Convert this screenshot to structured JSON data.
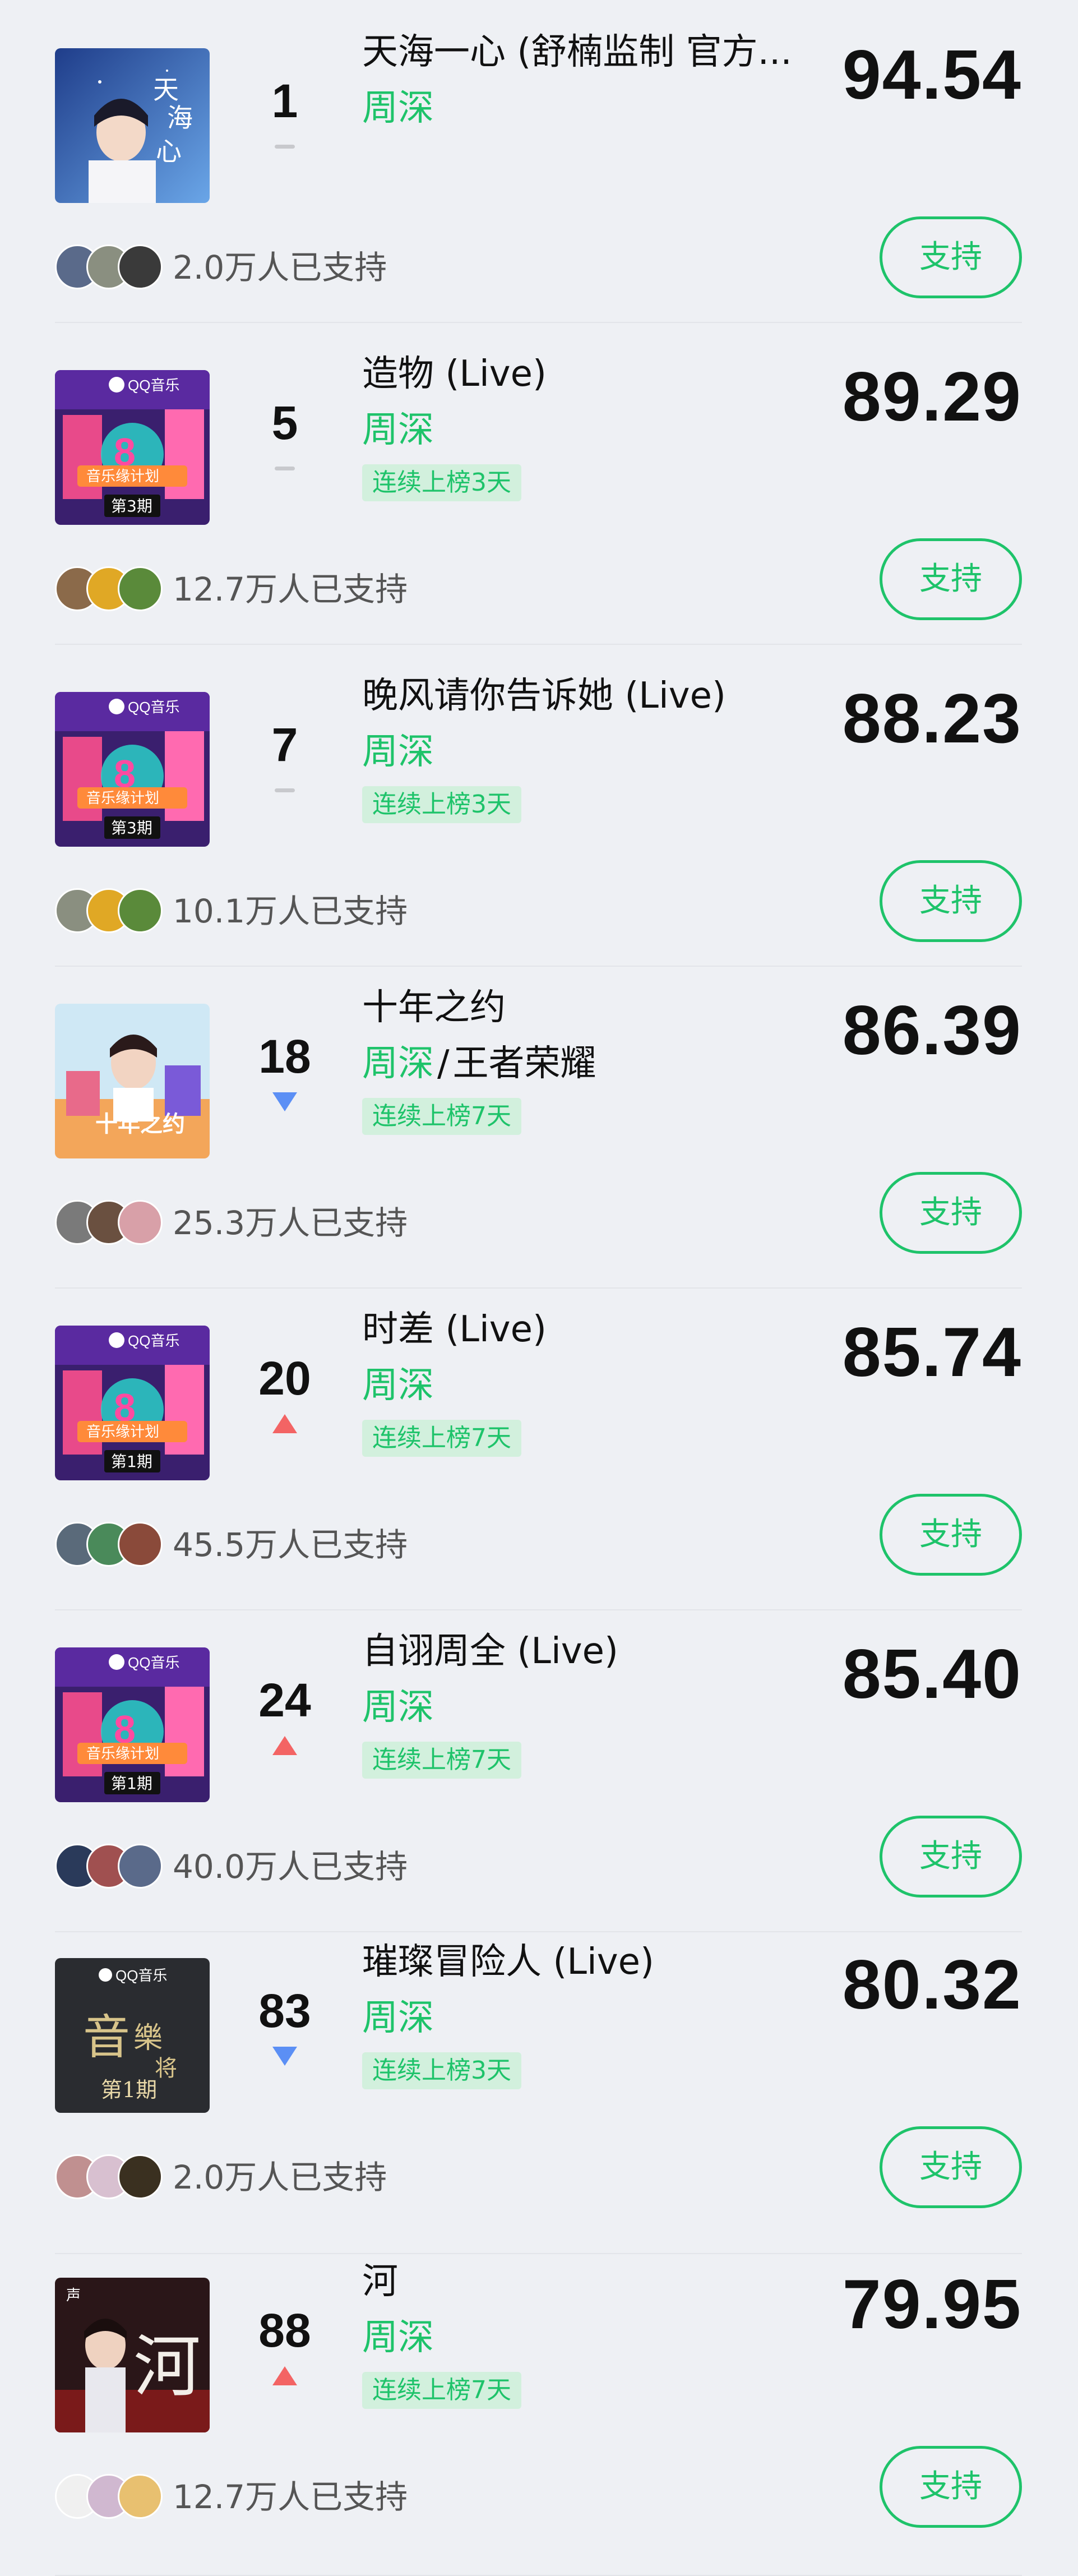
{
  "colors": {
    "accent": "#1ec36a",
    "up": "#f36464",
    "down": "#5b8ff5",
    "same": "#c8c9cd"
  },
  "songs": [
    {
      "rank": "1",
      "trend": "same",
      "title": "天海一心 (舒楠监制 官方...",
      "artist": "周深",
      "other_artist": "",
      "streak": "",
      "score": "94.54",
      "supporters": "2.0万人已支持",
      "button": "支持",
      "cover": "tianhai",
      "avatars": [
        "#5a6a8a",
        "#8a8f80",
        "#3a3a3a"
      ]
    },
    {
      "rank": "5",
      "trend": "same",
      "title": "造物 (Live)",
      "artist": "周深",
      "other_artist": "",
      "streak": "连续上榜3天",
      "score": "89.29",
      "supporters": "12.7万人已支持",
      "button": "支持",
      "cover": "show3",
      "avatars": [
        "#8b6a4a",
        "#e0a825",
        "#5a8a3a"
      ]
    },
    {
      "rank": "7",
      "trend": "same",
      "title": "晚风请你告诉她 (Live)",
      "artist": "周深",
      "other_artist": "",
      "streak": "连续上榜3天",
      "score": "88.23",
      "supporters": "10.1万人已支持",
      "button": "支持",
      "cover": "show3",
      "avatars": [
        "#8a8f80",
        "#e0a825",
        "#5a8a3a"
      ]
    },
    {
      "rank": "18",
      "trend": "down",
      "title": "十年之约",
      "artist": "周深",
      "other_artist": "王者荣耀",
      "streak": "连续上榜7天",
      "score": "86.39",
      "supporters": "25.3万人已支持",
      "button": "支持",
      "cover": "tenyear",
      "avatars": [
        "#7a7a7a",
        "#6a5040",
        "#d8a0a8"
      ]
    },
    {
      "rank": "20",
      "trend": "up",
      "title": "时差 (Live)",
      "artist": "周深",
      "other_artist": "",
      "streak": "连续上榜7天",
      "score": "85.74",
      "supporters": "45.5万人已支持",
      "button": "支持",
      "cover": "show1",
      "avatars": [
        "#5a6a7a",
        "#4a8a5a",
        "#8a4a3a"
      ]
    },
    {
      "rank": "24",
      "trend": "up",
      "title": "自诩周全 (Live)",
      "artist": "周深",
      "other_artist": "",
      "streak": "连续上榜7天",
      "score": "85.40",
      "supporters": "40.0万人已支持",
      "button": "支持",
      "cover": "show1",
      "avatars": [
        "#2a3a5a",
        "#a05050",
        "#5a6a8a"
      ]
    },
    {
      "rank": "83",
      "trend": "down",
      "title": "璀璨冒险人 (Live)",
      "artist": "周深",
      "other_artist": "",
      "streak": "连续上榜3天",
      "score": "80.32",
      "supporters": "2.0万人已支持",
      "button": "支持",
      "cover": "master",
      "avatars": [
        "#c09090",
        "#d8c0d0",
        "#3a3020"
      ]
    },
    {
      "rank": "88",
      "trend": "up",
      "title": "河",
      "artist": "周深",
      "other_artist": "",
      "streak": "连续上榜7天",
      "score": "79.95",
      "supporters": "12.7万人已支持",
      "button": "支持",
      "cover": "river",
      "avatars": [
        "#f0f0f0",
        "#d0b8d0",
        "#e8c070"
      ]
    }
  ]
}
